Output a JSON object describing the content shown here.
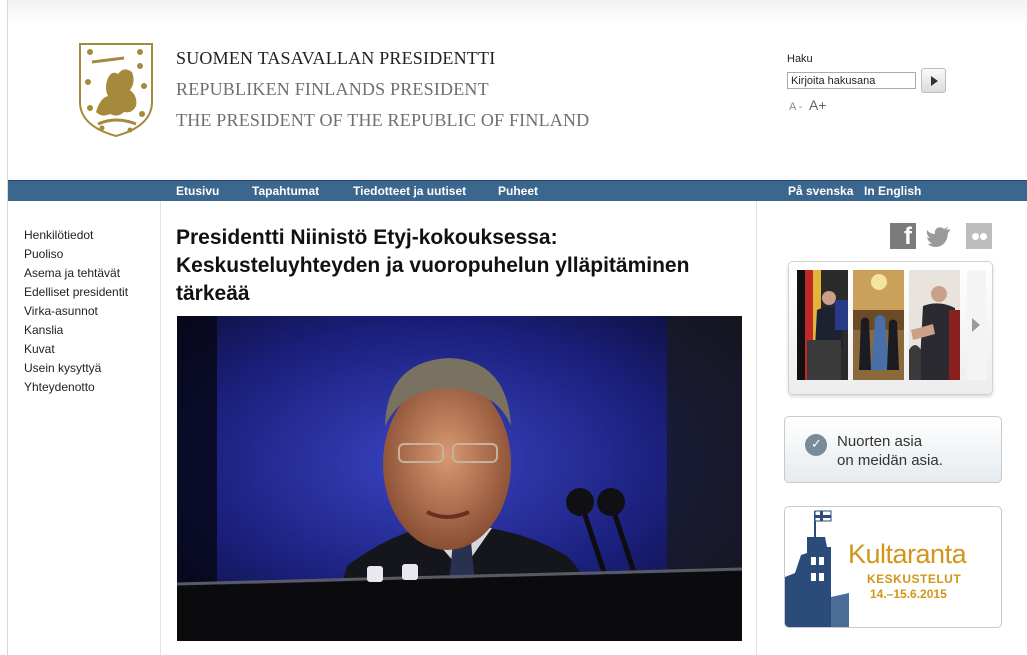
{
  "header": {
    "title_fi": "SUOMEN TASAVALLAN PRESIDENTTI",
    "title_sv": "REPUBLIKEN FINLANDS PRESIDENT",
    "title_en": "THE PRESIDENT OF THE REPUBLIC OF FINLAND",
    "logo_icon": "coat-of-arms-lion",
    "search": {
      "label": "Haku",
      "value": "Kirjoita hakusana",
      "button_icon": "play-arrow-icon"
    },
    "font_size": {
      "decrease": "A -",
      "increase": "A+"
    }
  },
  "nav": {
    "items": [
      {
        "label": "Etusivu"
      },
      {
        "label": "Tapahtumat"
      },
      {
        "label": "Tiedotteet ja uutiset"
      },
      {
        "label": "Puheet"
      }
    ],
    "languages": [
      {
        "label": "På svenska"
      },
      {
        "label": "In English"
      }
    ],
    "bar_color": "#3b678e"
  },
  "sidebar": {
    "items": [
      {
        "label": "Henkilötiedot"
      },
      {
        "label": "Puoliso"
      },
      {
        "label": "Asema ja tehtävät"
      },
      {
        "label": "Edelliset presidentit"
      },
      {
        "label": "Virka-asunnot"
      },
      {
        "label": "Kanslia"
      },
      {
        "label": "Kuvat"
      },
      {
        "label": "Usein kysyttyä"
      },
      {
        "label": "Yhteydenotto"
      }
    ]
  },
  "main": {
    "headline": "Presidentti Niinistö Etyj-kokouksessa: Keskusteluyhteyden ja vuoropuhelun ylläpitäminen tärkeää",
    "photo_icon": "speaker-at-podium-photo"
  },
  "right": {
    "social": [
      "facebook-icon",
      "twitter-icon",
      "flickr-icon"
    ],
    "gallery": {
      "thumbnails": [
        "thumb-podium",
        "thumb-reception",
        "thumb-handshake"
      ],
      "next_icon": "chevron-right-icon"
    },
    "youth_banner": {
      "line1": "Nuorten asia",
      "line2": "on meidän asia."
    },
    "kultaranta": {
      "name": "Kultaranta",
      "subtitle": "KESKUSTELUT",
      "dates": "14.–15.6.2015",
      "accent_color": "#d19619"
    }
  }
}
